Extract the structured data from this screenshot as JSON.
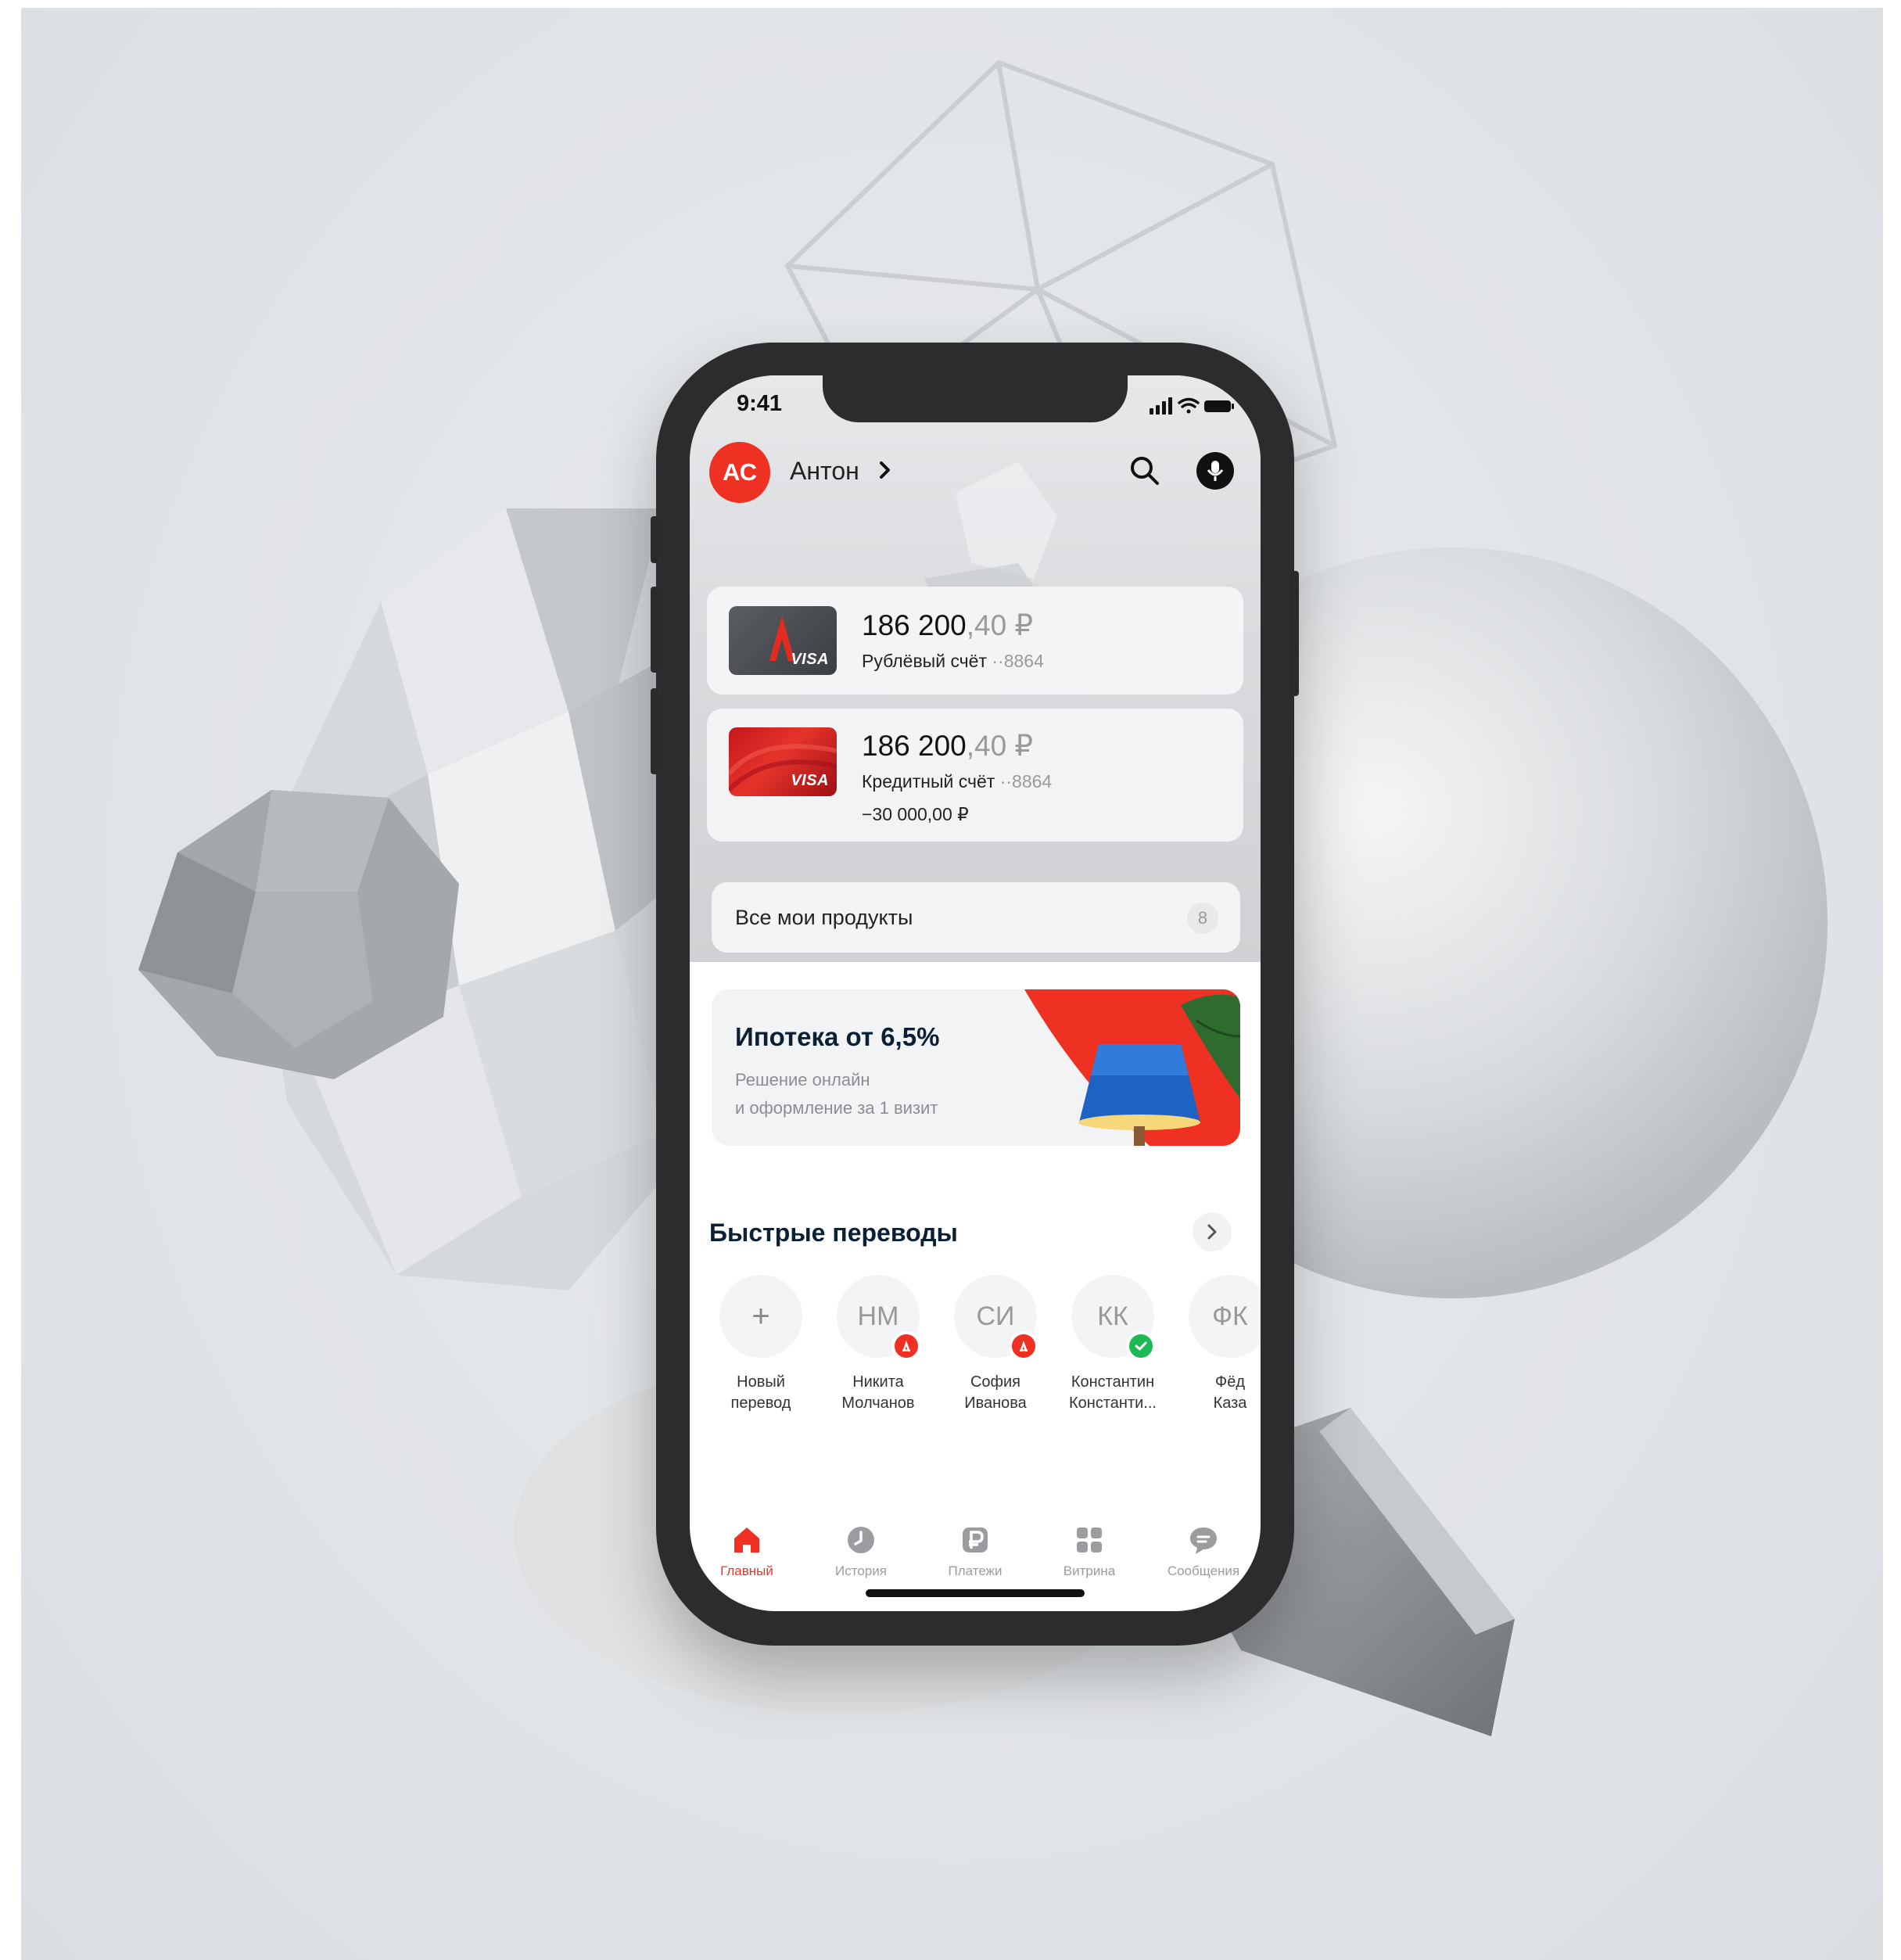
{
  "status_bar": {
    "time": "9:41"
  },
  "header": {
    "avatar_initials": "АС",
    "user_name": "Антон",
    "icons": [
      "chevron-right-icon",
      "search-icon",
      "microphone-icon"
    ]
  },
  "accounts": [
    {
      "amount_main": "186 200",
      "amount_cents": ",40 ₽",
      "name": "Рублёвый счёт",
      "number": "··8864",
      "card_brand": "VISA"
    },
    {
      "amount_main": "186 200",
      "amount_cents": ",40 ₽",
      "name": "Кредитный счёт",
      "number": "··8864",
      "limit": "−30 000,00 ₽",
      "card_brand": "VISA"
    }
  ],
  "all_products": {
    "label": "Все мои продукты",
    "count": "8"
  },
  "promo": {
    "title": "Ипотека от 6,5%",
    "subtitle": "Решение онлайн\nи оформление за 1 визит"
  },
  "quick_transfers": {
    "title": "Быстрые переводы",
    "contacts": [
      {
        "initials": "+",
        "name": "Новый\nперевод",
        "badge": ""
      },
      {
        "initials": "НМ",
        "name": "Никита\nМолчанов",
        "badge": "alfa"
      },
      {
        "initials": "СИ",
        "name": "София\nИванова",
        "badge": "alfa"
      },
      {
        "initials": "КК",
        "name": "Константин\nКонстанти...",
        "badge": "check"
      },
      {
        "initials": "ФК",
        "name": "Фёд\nКаза",
        "badge": ""
      }
    ]
  },
  "tabbar": {
    "items": [
      {
        "label": "Главный",
        "icon": "home-icon",
        "active": true
      },
      {
        "label": "История",
        "icon": "clock-icon",
        "active": false
      },
      {
        "label": "Платежи",
        "icon": "ruble-icon",
        "active": false
      },
      {
        "label": "Витрина",
        "icon": "grid-icon",
        "active": false
      },
      {
        "label": "Сообщения",
        "icon": "chat-icon",
        "active": false
      }
    ]
  },
  "colors": {
    "accent": "#EF3124",
    "text_dark": "#0B1F35",
    "check": "#1DB954"
  }
}
